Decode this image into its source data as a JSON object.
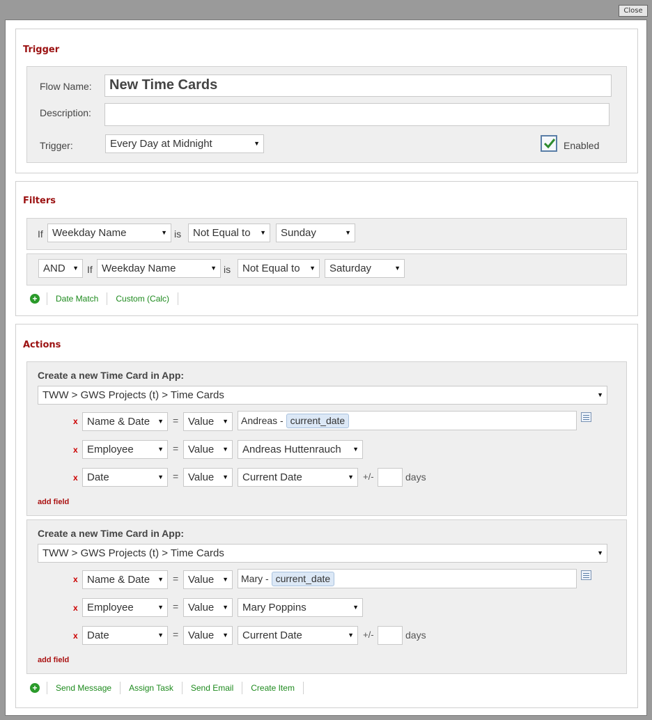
{
  "window": {
    "close_label": "Close"
  },
  "trigger": {
    "title": "Trigger",
    "flow_name_label": "Flow Name:",
    "flow_name_value": "New Time Cards",
    "description_label": "Description:",
    "description_value": "",
    "trigger_label": "Trigger:",
    "trigger_value": "Every Day at Midnight",
    "enabled_label": "Enabled",
    "enabled": true
  },
  "filters": {
    "title": "Filters",
    "rows": [
      {
        "prefix": "If",
        "field": "Weekday Name",
        "is": "is",
        "op": "Not Equal to",
        "value": "Sunday"
      },
      {
        "conj": "AND",
        "prefix": "If",
        "field": "Weekday Name",
        "is": "is",
        "op": "Not Equal to",
        "value": "Saturday"
      }
    ],
    "links": [
      "Date Match",
      "Custom (Calc)"
    ]
  },
  "actions": {
    "title": "Actions",
    "items": [
      {
        "heading": "Create a new Time Card in App:",
        "app_path": "TWW > GWS Projects (t) > Time Cards",
        "fields": [
          {
            "remove": "x",
            "field": "Name & Date",
            "eq": "=",
            "mode": "Value",
            "text_prefix": "Andreas -",
            "token": "current_date"
          },
          {
            "remove": "x",
            "field": "Employee",
            "eq": "=",
            "mode": "Value",
            "value": "Andreas Huttenrauch"
          },
          {
            "remove": "x",
            "field": "Date",
            "eq": "=",
            "mode": "Value",
            "value": "Current Date",
            "plusminus": "+/-",
            "days_label": "days"
          }
        ],
        "add_field": "add field"
      },
      {
        "heading": "Create a new Time Card in App:",
        "app_path": "TWW > GWS Projects (t) > Time Cards",
        "fields": [
          {
            "remove": "x",
            "field": "Name & Date",
            "eq": "=",
            "mode": "Value",
            "text_prefix": "Mary -",
            "token": "current_date"
          },
          {
            "remove": "x",
            "field": "Employee",
            "eq": "=",
            "mode": "Value",
            "value": "Mary Poppins"
          },
          {
            "remove": "x",
            "field": "Date",
            "eq": "=",
            "mode": "Value",
            "value": "Current Date",
            "plusminus": "+/-",
            "days_label": "days"
          }
        ],
        "add_field": "add field"
      }
    ],
    "links": [
      "Send Message",
      "Assign Task",
      "Send Email",
      "Create Item"
    ]
  },
  "colors": {
    "section_title": "#9b1111",
    "link": "#1d8a1d",
    "remove": "#cc0000"
  },
  "icons": {
    "add": "plus-circle-icon",
    "field_picker": "field-list-icon",
    "dropdown": "chevron-down-icon",
    "enabled": "checkmark-icon"
  }
}
